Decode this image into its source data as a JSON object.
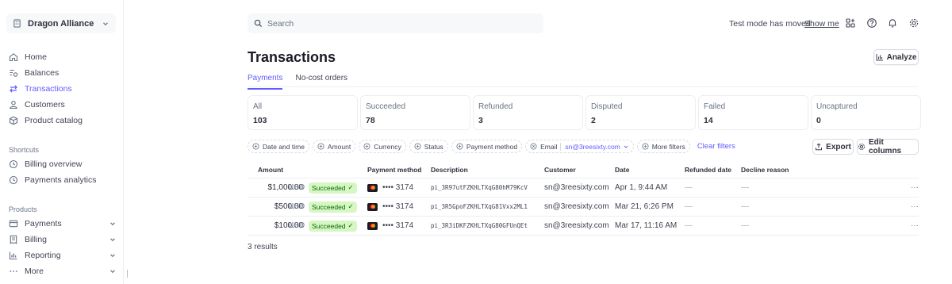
{
  "account": {
    "name": "Dragon Alliance"
  },
  "nav": [
    {
      "label": "Home",
      "icon": "home-icon"
    },
    {
      "label": "Balances",
      "icon": "balances-icon"
    },
    {
      "label": "Transactions",
      "icon": "transactions-icon",
      "active": true
    },
    {
      "label": "Customers",
      "icon": "customers-icon"
    },
    {
      "label": "Product catalog",
      "icon": "product-catalog-icon"
    }
  ],
  "shortcuts": {
    "title": "Shortcuts",
    "items": [
      {
        "label": "Billing overview",
        "icon": "history-icon"
      },
      {
        "label": "Payments analytics",
        "icon": "history-icon"
      }
    ]
  },
  "products": {
    "title": "Products",
    "items": [
      {
        "label": "Payments",
        "icon": "payments-icon"
      },
      {
        "label": "Billing",
        "icon": "billing-icon"
      },
      {
        "label": "Reporting",
        "icon": "reporting-icon"
      },
      {
        "label": "More",
        "icon": "more-icon"
      }
    ]
  },
  "topbar": {
    "search_placeholder": "Search",
    "test_mode_text": "Test mode has moved",
    "show_me": "Show me"
  },
  "page": {
    "title": "Transactions",
    "analyze_label": "Analyze",
    "tabs": [
      {
        "label": "Payments",
        "active": true
      },
      {
        "label": "No-cost orders",
        "active": false
      }
    ]
  },
  "status_cards": [
    {
      "label": "All",
      "count": "103"
    },
    {
      "label": "Succeeded",
      "count": "78"
    },
    {
      "label": "Refunded",
      "count": "3"
    },
    {
      "label": "Disputed",
      "count": "2"
    },
    {
      "label": "Failed",
      "count": "14"
    },
    {
      "label": "Uncaptured",
      "count": "0"
    }
  ],
  "filters": {
    "chips": [
      "Date and time",
      "Amount",
      "Currency",
      "Status",
      "Payment method"
    ],
    "email_label": "Email",
    "email_value": "sn@3reesixty.com",
    "more_filters": "More filters",
    "clear_filters": "Clear filters",
    "export_label": "Export",
    "edit_columns_label": "Edit columns"
  },
  "table": {
    "columns": [
      "Amount",
      "Payment method",
      "Description",
      "Customer",
      "Date",
      "Refunded date",
      "Decline reason"
    ],
    "rows": [
      {
        "amount": "$1,000.00",
        "currency": "USD",
        "status": "Succeeded",
        "card": "•••• 3174",
        "description": "pi_3R97utFZKHLTXqG80hM79KcV",
        "customer": "sn@3reesixty.com",
        "date": "Apr 1, 9:44 AM",
        "refunded": "—",
        "decline": "—"
      },
      {
        "amount": "$500.00",
        "currency": "USD",
        "status": "Succeeded",
        "card": "•••• 3174",
        "description": "pi_3R5GpoFZKHLTXqG81Vxx2ML1",
        "customer": "sn@3reesixty.com",
        "date": "Mar 21, 6:26 PM",
        "refunded": "—",
        "decline": "—"
      },
      {
        "amount": "$100.00",
        "currency": "USD",
        "status": "Succeeded",
        "card": "•••• 3174",
        "description": "pi_3R3iDKFZKHLTXqG80GFUnQEt",
        "customer": "sn@3reesixty.com",
        "date": "Mar 17, 11:16 AM",
        "refunded": "—",
        "decline": "—"
      }
    ],
    "row_more": "···",
    "results_text": "3 results"
  },
  "colors": {
    "accent": "#635bff",
    "success_bg": "#d7f7c2",
    "success_text": "#05690d"
  }
}
